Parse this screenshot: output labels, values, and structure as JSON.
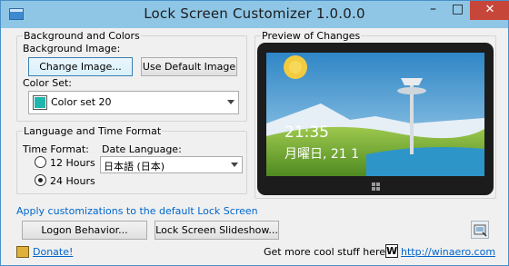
{
  "window": {
    "title": "Lock Screen Customizer 1.0.0.0",
    "minimize_glyph": "–",
    "maximize_glyph": "□",
    "close_glyph": "✕"
  },
  "background": {
    "group_title": "Background and Colors",
    "background_image_label": "Background Image:",
    "change_image_button": "Change Image...",
    "default_image_button": "Use Default Image",
    "color_set_label": "Color Set:",
    "color_set_value": "Color set 20",
    "color_swatch": "#1fb7ad"
  },
  "language": {
    "group_title": "Language and Time Format",
    "time_format_label": "Time Format:",
    "options": [
      "12 Hours",
      "24 Hours"
    ],
    "selected_option": "24 Hours",
    "date_language_label": "Date Language:",
    "date_language_value": "日本語 (日本)"
  },
  "preview": {
    "group_title": "Preview of Changes",
    "time": "21:35",
    "date": "月曜日, 21 1"
  },
  "apply_link": "Apply customizations to the default Lock Screen",
  "buttons": {
    "logon_behavior": "Logon Behavior...",
    "slideshow": "Lock Screen Slideshow..."
  },
  "footer": {
    "donate_link": "Donate!",
    "more_text": "Get more cool stuff here:",
    "winaero_logo_letter": "W",
    "winaero_link": "http://winaero.com"
  }
}
